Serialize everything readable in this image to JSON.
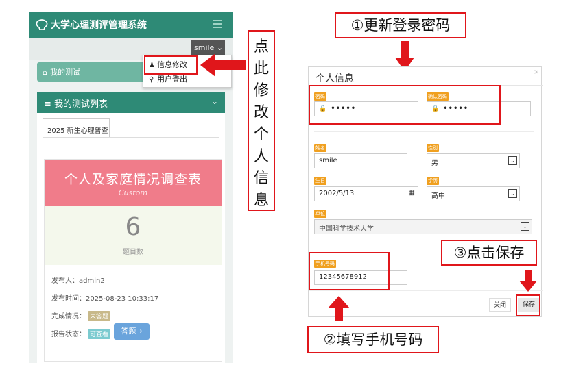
{
  "app": {
    "title": "大学心理测评管理系统",
    "user_name": "smile",
    "user_caret": "⌄",
    "breadcrumb_icon": "home-icon",
    "breadcrumb_glyph": "⌂",
    "breadcrumb": "我的测试",
    "user_menu": {
      "edit_label": "信息修改",
      "logout_label": "用户登出"
    },
    "card": {
      "title": "我的测试列表",
      "title_glyph": "≡",
      "chevron": "⌄",
      "tab_label": "2025 新生心理普查",
      "survey": {
        "title": "个人及家庭情况调查表",
        "subtitle": "Custom",
        "question_count": "6",
        "question_count_label": "题目数",
        "publisher_label": "发布人：",
        "publisher": "admin2",
        "publish_time_label": "发布时间：",
        "publish_time": "2025-08-23 10:33:17",
        "completion_label": "完成情况：",
        "completion_status": "未答题",
        "report_label": "报告状态：",
        "report_status": "可查看",
        "answer_button": "答题→"
      }
    }
  },
  "annotations": {
    "step1": "①更新登录密码",
    "step2": "②填写手机号码",
    "step3": "③点击保存",
    "callout_chars": [
      "点",
      "此",
      "修",
      "改",
      "个",
      "人",
      "信",
      "息"
    ]
  },
  "modal": {
    "title": "个人信息",
    "close_x": "×",
    "password_label": "密码",
    "password_value": "•••••",
    "confirm_password_label": "确认密码",
    "confirm_password_value": "•••••",
    "name_label": "姓名",
    "name_value": "smile",
    "gender_label": "性别",
    "gender_value": "男",
    "birthday_label": "生日",
    "birthday_value": "2002/5/13",
    "education_label": "学历",
    "education_value": "高中",
    "org_label": "单位",
    "org_value": "中国科学技术大学",
    "phone_label": "手机号码",
    "phone_value": "12345678912",
    "close_button": "关闭",
    "save_button": "保存"
  },
  "colors": {
    "header_green": "#2e8a76",
    "annotation_red": "#e0161b",
    "label_orange": "#f0a020",
    "banner_pink": "#f07c8a"
  }
}
